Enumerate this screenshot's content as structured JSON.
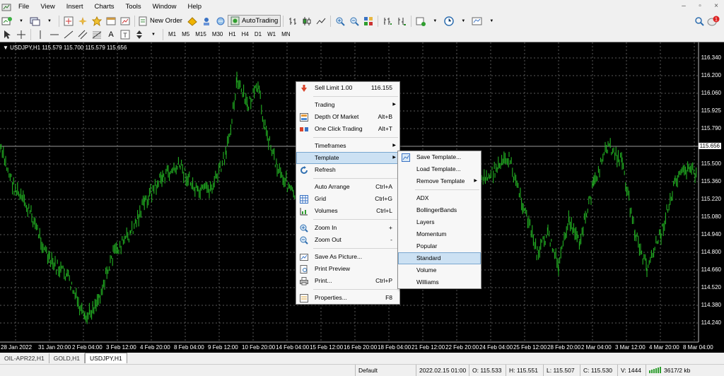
{
  "menubar": {
    "items": [
      "File",
      "View",
      "Insert",
      "Charts",
      "Tools",
      "Window",
      "Help"
    ]
  },
  "toolbar": {
    "new_order": "New Order",
    "autotrading": "AutoTrading",
    "timeframes": [
      "M1",
      "M5",
      "M15",
      "M30",
      "H1",
      "H4",
      "D1",
      "W1",
      "MN"
    ]
  },
  "chart": {
    "symbol_label": "USDJPY,H1  115.579 115.700 115.579 115.656",
    "current_price": "115.656",
    "price_ticks": [
      "116.340",
      "116.200",
      "116.060",
      "115.925",
      "115.790",
      "115.656",
      "115.500",
      "115.360",
      "115.220",
      "115.080",
      "114.940",
      "114.800",
      "114.660",
      "114.520",
      "114.380",
      "114.240"
    ],
    "date_ticks": [
      "28 Jan 2022",
      "31 Jan 20:00",
      "2 Feb 04:00",
      "3 Feb 12:00",
      "4 Feb 20:00",
      "8 Feb 04:00",
      "9 Feb 12:00",
      "10 Feb 20:00",
      "14 Feb 04:00",
      "15 Feb 12:00",
      "16 Feb 20:00",
      "18 Feb 04:00",
      "21 Feb 12:00",
      "22 Feb 20:00",
      "24 Feb 04:00",
      "25 Feb 12:00",
      "28 Feb 20:00",
      "2 Mar 04:00",
      "3 Mar 12:00",
      "4 Mar 20:00",
      "8 Mar 04:00"
    ],
    "colors": {
      "background": "#000000",
      "candles": "#22b022",
      "grid": "#5a5a5a"
    }
  },
  "context_menu": {
    "items": [
      {
        "label": "Sell Limit 1.00",
        "shortcut": "116.155",
        "icon": "sell-limit-icon"
      },
      {
        "sep": true
      },
      {
        "label": "Trading",
        "submenu": true
      },
      {
        "label": "Depth Of Market",
        "shortcut": "Alt+B",
        "icon": "depth-of-market-icon"
      },
      {
        "label": "One Click Trading",
        "shortcut": "Alt+T",
        "icon": "one-click-trading-icon"
      },
      {
        "sep": true
      },
      {
        "label": "Timeframes",
        "submenu": true
      },
      {
        "label": "Template",
        "submenu": true,
        "highlighted": true
      },
      {
        "label": "Refresh",
        "icon": "refresh-icon"
      },
      {
        "sep": true
      },
      {
        "label": "Auto Arrange",
        "shortcut": "Ctrl+A"
      },
      {
        "label": "Grid",
        "shortcut": "Ctrl+G",
        "icon": "grid-icon"
      },
      {
        "label": "Volumes",
        "shortcut": "Ctrl+L",
        "icon": "volumes-icon"
      },
      {
        "sep": true
      },
      {
        "label": "Zoom In",
        "shortcut": "+",
        "icon": "zoom-in-icon"
      },
      {
        "label": "Zoom Out",
        "shortcut": "-",
        "icon": "zoom-out-icon"
      },
      {
        "sep": true
      },
      {
        "label": "Save As Picture...",
        "icon": "save-picture-icon"
      },
      {
        "label": "Print Preview",
        "icon": "print-preview-icon"
      },
      {
        "label": "Print...",
        "shortcut": "Ctrl+P",
        "icon": "print-icon"
      },
      {
        "sep": true
      },
      {
        "label": "Properties...",
        "shortcut": "F8",
        "icon": "properties-icon"
      }
    ]
  },
  "template_submenu": {
    "items": [
      {
        "label": "Save Template...",
        "icon": "save-template-icon"
      },
      {
        "label": "Load Template..."
      },
      {
        "label": "Remove Template",
        "submenu": true
      },
      {
        "sep": true
      },
      {
        "label": "ADX"
      },
      {
        "label": "BollingerBands"
      },
      {
        "label": "Layers"
      },
      {
        "label": "Momentum"
      },
      {
        "label": "Popular"
      },
      {
        "label": "Standard",
        "highlighted": true
      },
      {
        "label": "Volume"
      },
      {
        "label": "Williams"
      }
    ]
  },
  "tabs": [
    {
      "label": "OIL-APR22,H1"
    },
    {
      "label": "GOLD,H1"
    },
    {
      "label": "USDJPY,H1",
      "active": true
    }
  ],
  "status": {
    "profile": "Default",
    "datetime": "2022.02.15 01:00",
    "open": "O: 115.533",
    "high": "H: 115.551",
    "low": "L: 115.507",
    "close": "C: 115.530",
    "volume": "V: 1444",
    "traffic": "3617/2 kb"
  }
}
